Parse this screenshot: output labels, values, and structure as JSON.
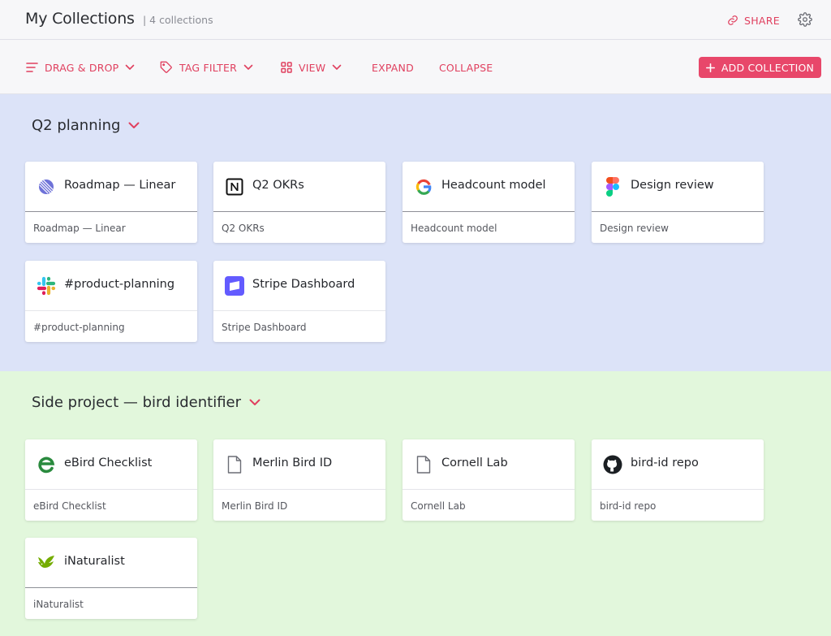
{
  "header": {
    "title": "My Collections",
    "count": "| 4 collections",
    "share_label": "SHARE"
  },
  "toolbar": {
    "drag_drop": "DRAG & DROP",
    "tag_filter": "TAG FILTER",
    "view": "VIEW",
    "expand": "EXPAND",
    "collapse": "COLLAPSE",
    "add_collection": "ADD COLLECTION"
  },
  "colors": {
    "accent": "#e0405f",
    "section1_bg": "#dce3f8",
    "section2_bg": "#e2f7dc"
  },
  "collections": [
    {
      "title": "Q2 planning",
      "items": [
        {
          "title": "Roadmap — Linear",
          "subtitle": "Roadmap — Linear",
          "icon": "linear-icon"
        },
        {
          "title": "Q2 OKRs",
          "subtitle": "Q2 OKRs",
          "icon": "notion-icon"
        },
        {
          "title": "Headcount model",
          "subtitle": "Headcount model",
          "icon": "google-icon"
        },
        {
          "title": "Design review",
          "subtitle": "Design review",
          "icon": "figma-icon"
        },
        {
          "title": "#product-planning",
          "subtitle": "#product-planning",
          "icon": "slack-icon"
        },
        {
          "title": "Stripe Dashboard",
          "subtitle": "Stripe Dashboard",
          "icon": "stripe-icon"
        }
      ]
    },
    {
      "title": "Side project — bird identifier",
      "items": [
        {
          "title": "eBird Checklist",
          "subtitle": "eBird Checklist",
          "icon": "ebird-icon"
        },
        {
          "title": "Merlin Bird ID",
          "subtitle": "Merlin Bird ID",
          "icon": "document-icon"
        },
        {
          "title": "Cornell Lab",
          "subtitle": "Cornell Lab",
          "icon": "document-icon"
        },
        {
          "title": "bird-id repo",
          "subtitle": "bird-id repo",
          "icon": "github-icon"
        },
        {
          "title": "iNaturalist",
          "subtitle": "iNaturalist",
          "icon": "inaturalist-icon"
        }
      ]
    }
  ]
}
